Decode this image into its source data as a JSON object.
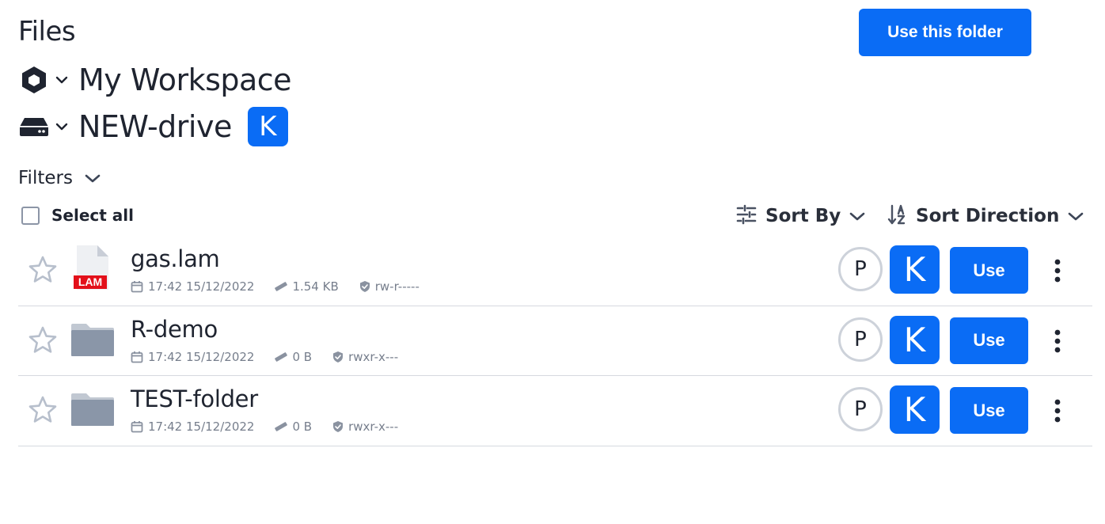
{
  "header": {
    "title": "Files",
    "use_folder_label": "Use this folder"
  },
  "breadcrumbs": {
    "workspace": {
      "label": "My Workspace",
      "icon": "hexagon-workspace-icon"
    },
    "drive": {
      "label": "NEW-drive",
      "icon": "hard-drive-icon",
      "badge": "K"
    }
  },
  "filters": {
    "label": "Filters"
  },
  "toolbar": {
    "select_all_label": "Select all",
    "sort_by_label": "Sort By",
    "sort_direction_label": "Sort Direction"
  },
  "files": [
    {
      "name": "gas.lam",
      "type": "lam-file",
      "type_badge": "LAM",
      "modified": "17:42 15/12/2022",
      "size": "1.54 KB",
      "permissions": "rw-r-----",
      "avatar_p": "P",
      "avatar_k": "K",
      "use_label": "Use"
    },
    {
      "name": "R-demo",
      "type": "folder",
      "modified": "17:42 15/12/2022",
      "size": "0 B",
      "permissions": "rwxr-x---",
      "avatar_p": "P",
      "avatar_k": "K",
      "use_label": "Use"
    },
    {
      "name": "TEST-folder",
      "type": "folder",
      "modified": "17:42 15/12/2022",
      "size": "0 B",
      "permissions": "rwxr-x---",
      "avatar_p": "P",
      "avatar_k": "K",
      "use_label": "Use"
    }
  ],
  "colors": {
    "primary": "#0a6cf5",
    "text": "#1f2430",
    "muted": "#767e8c",
    "folder": "#8a96a8",
    "lam_badge": "#e3101a"
  }
}
